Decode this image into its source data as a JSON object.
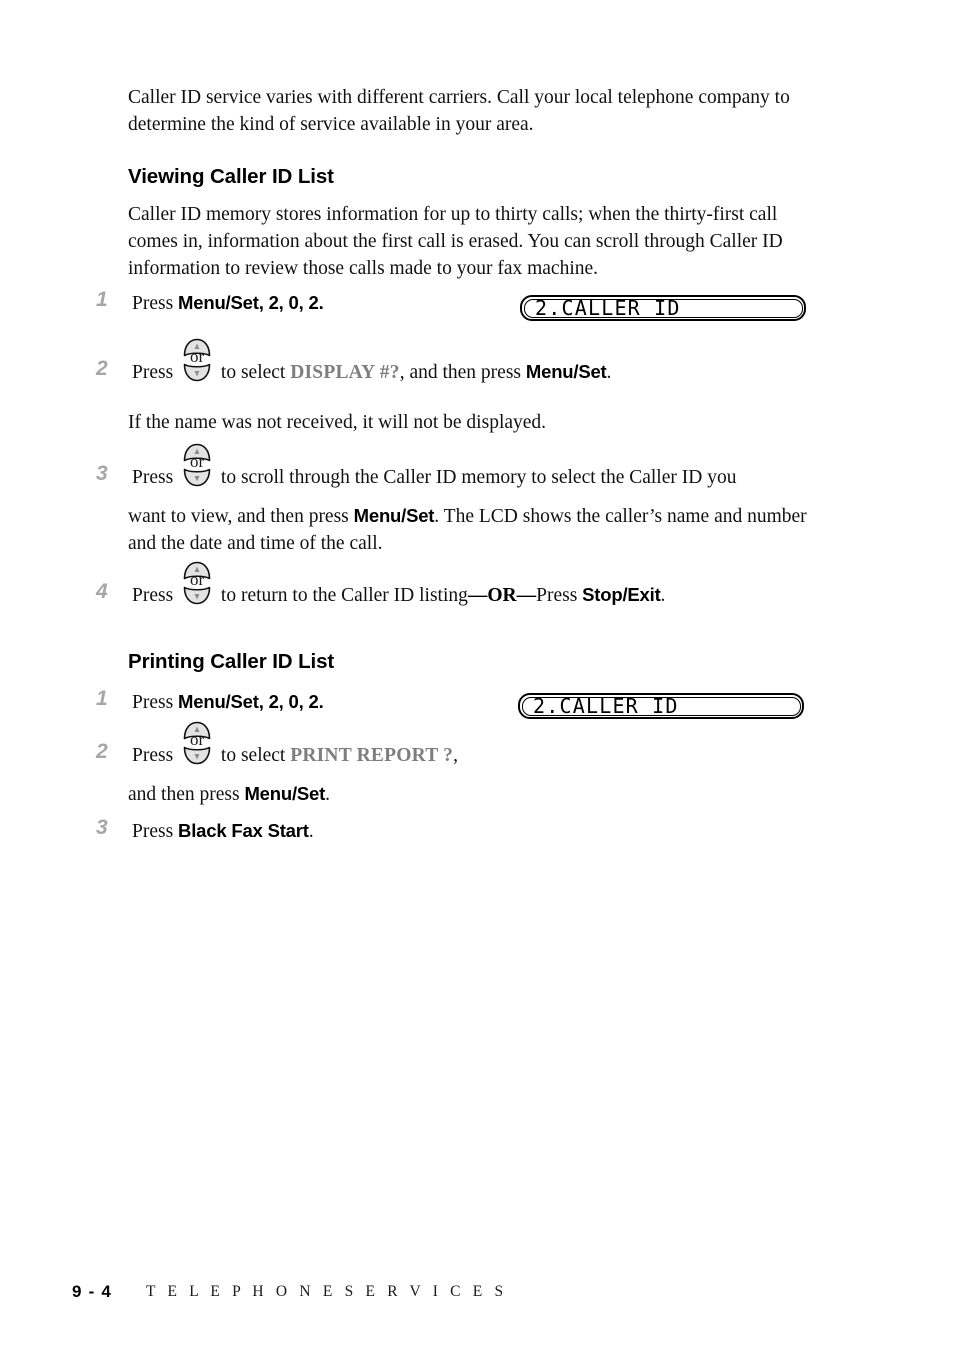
{
  "document": {
    "intro_paragraph": "Caller ID service varies with different carriers.  Call your local telephone company to determine the kind of service available in your area."
  },
  "sections": [
    {
      "heading": "Viewing Caller ID List",
      "intro": "Caller ID memory stores information for up to thirty calls; when the thirty-first call comes in, information about the first call is erased.  You can scroll through Caller ID information to review those calls made to your fax machine.",
      "steps": [
        {
          "number": "1",
          "press_label": "Press",
          "key": "Menu/Set",
          "digits": ", 2, 0, 2.",
          "digit_2": "2",
          "digit_0": "0",
          "digit_2b": "2"
        },
        {
          "number": "2",
          "press_label": "Press",
          "icon": "updown-arrow-key-icon",
          "or_label": "or",
          "mid_text": "to select",
          "selection": "DISPLAY #?",
          "after_selection": ", and then press",
          "key": "Menu/Set",
          "trailing": "."
        },
        {
          "number": "3",
          "press_label": "Press",
          "icon": "updown-arrow-key-icon",
          "or_label": "or",
          "mid_text": "to scroll through the Caller ID memory to select the Caller ID you",
          "line2_a": "want to view, and then press",
          "key": "Menu/Set",
          "line2_b": ". The LCD shows the caller’s name and number and the date and time of the call."
        },
        {
          "number": "4",
          "press_label": "Press",
          "icon": "updown-arrow-key-icon",
          "or_label": "or",
          "mid_text": "to return to the Caller ID listing",
          "dash1": "—",
          "or_bold": "OR",
          "dash2": "—",
          "after_or": "Press",
          "key": "Stop/Exit",
          "trailing": "."
        }
      ],
      "note": "If the name was not received, it will not be displayed.",
      "lcd": "2.CALLER ID"
    },
    {
      "heading": "Printing Caller ID List",
      "steps": [
        {
          "number": "1",
          "press_label": "Press",
          "key": "Menu/Set",
          "digits": ", 2, 0, 2."
        },
        {
          "number": "2",
          "press_label": "Press",
          "icon": "updown-arrow-key-icon",
          "or_label": "or",
          "mid_text": "to select",
          "selection": "PRINT REPORT ?",
          "after_selection": ",",
          "line2_a": "and then press",
          "key": "Menu/Set",
          "line2_b": "."
        },
        {
          "number": "3",
          "press_label": "Press",
          "key": "Black Fax Start",
          "trailing": "."
        }
      ],
      "lcd": "2.CALLER ID"
    }
  ],
  "footer": {
    "page_number": "9 - 4",
    "section_name": "T E L E P H O N E   S E R V I C E S"
  },
  "colors": {
    "step_number": "#a6a6a6",
    "emphasis_gray": "#7e7e7e",
    "text": "#111111",
    "key_icon_fill": "#e3e3e3"
  }
}
